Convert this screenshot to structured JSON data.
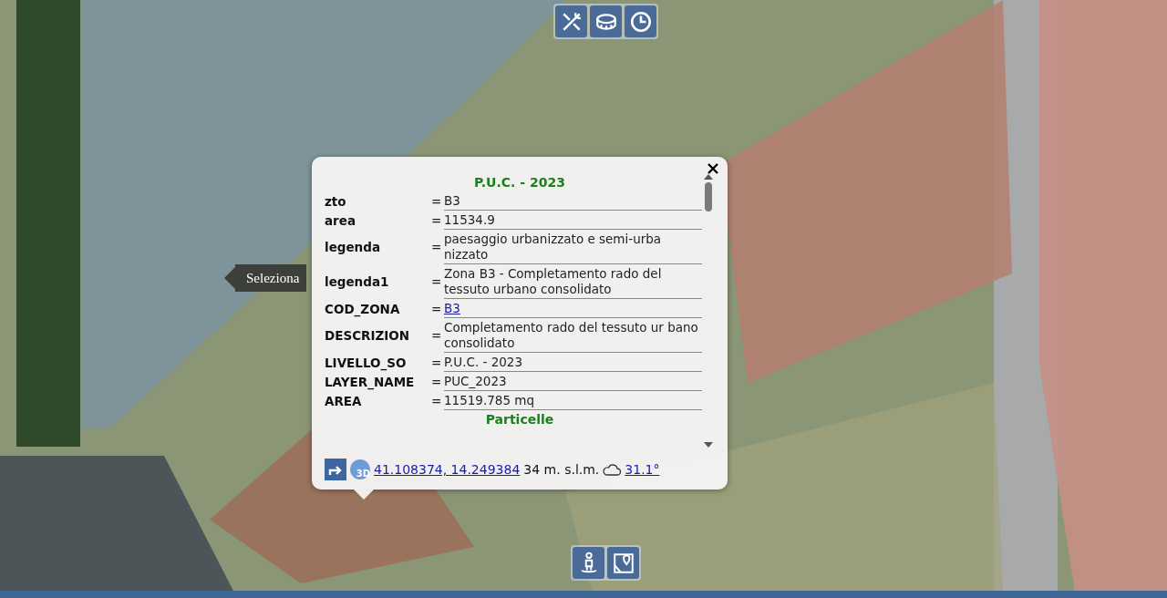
{
  "tooltip": {
    "text": "Seleziona"
  },
  "popup": {
    "title": "P.U.C. - 2023",
    "rows": [
      {
        "key": "zto",
        "sep": "=",
        "value": "B3",
        "kind": "text"
      },
      {
        "key": "area",
        "sep": "=",
        "value": "11534.9",
        "kind": "text"
      },
      {
        "key": "legenda",
        "sep": "=",
        "value": "paesaggio urbanizzato e semi-urba nizzato",
        "kind": "text"
      },
      {
        "key": "legenda1",
        "sep": "=",
        "value": "Zona B3 - Completamento rado del tessuto urbano consolidato",
        "kind": "text"
      },
      {
        "key": "COD_ZONA",
        "sep": "=",
        "value": "B3",
        "kind": "link"
      },
      {
        "key": "DESCRIZION",
        "sep": "=",
        "value": "Completamento rado del tessuto ur bano consolidato",
        "kind": "text"
      },
      {
        "key": "LIVELLO_SO",
        "sep": "=",
        "value": "P.U.C. - 2023",
        "kind": "text"
      },
      {
        "key": "LAYER_NAME",
        "sep": "=",
        "value": "PUC_2023",
        "kind": "text"
      },
      {
        "key": "AREA",
        "sep": "=",
        "value": "11519.785 mq",
        "kind": "text"
      }
    ],
    "section": "Particelle",
    "footer": {
      "badge": "3D",
      "coordinates": "41.108374, 14.249384",
      "elevation": "34 m. s.l.m.",
      "temperature": "31.1°"
    }
  }
}
